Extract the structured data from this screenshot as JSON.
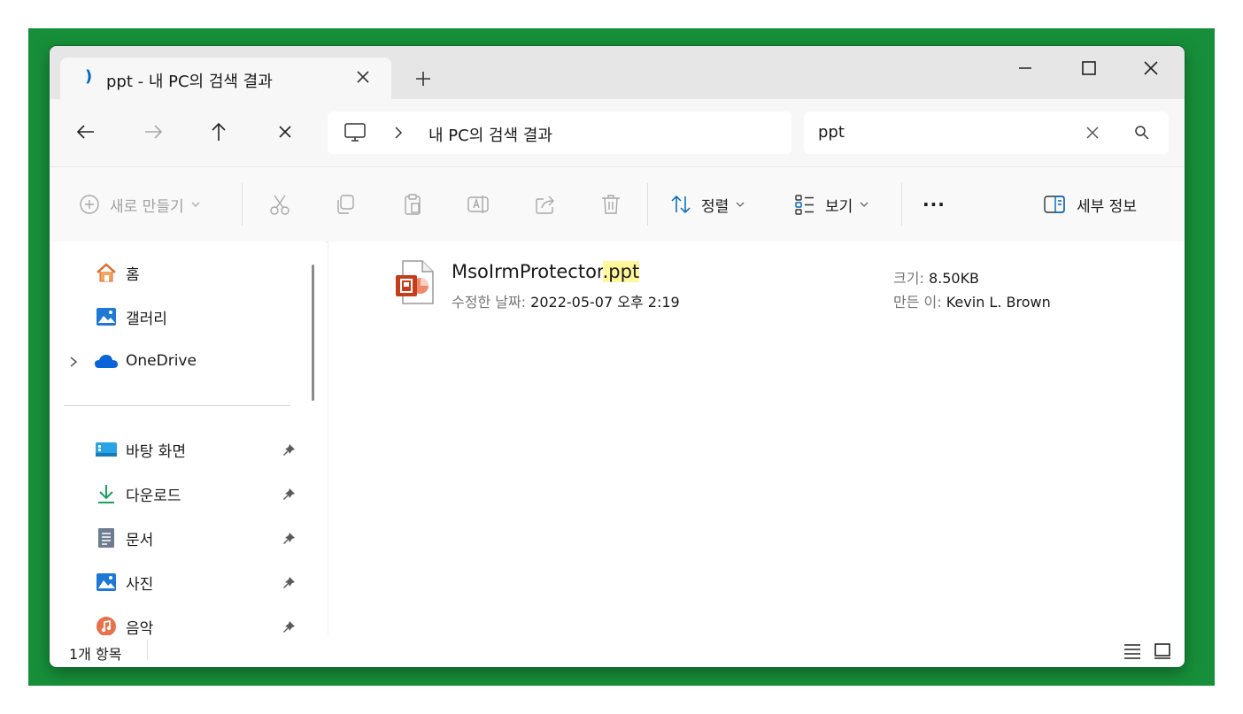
{
  "window": {
    "tab_title": "ppt - 내 PC의 검색 결과",
    "new_tab_label": "+"
  },
  "nav": {
    "address_path": "내 PC의 검색 결과",
    "search_value": "ppt"
  },
  "toolbar": {
    "new_label": "새로 만들기",
    "sort_label": "정렬",
    "view_label": "보기",
    "more_label": "···",
    "details_label": "세부 정보"
  },
  "sidebar": {
    "items": [
      {
        "label": "홈",
        "icon": "home-icon"
      },
      {
        "label": "갤러리",
        "icon": "gallery-icon"
      },
      {
        "label": "OneDrive",
        "icon": "onedrive-icon"
      }
    ],
    "pinned": [
      {
        "label": "바탕 화면",
        "icon": "desktop-icon"
      },
      {
        "label": "다운로드",
        "icon": "download-icon"
      },
      {
        "label": "문서",
        "icon": "documents-icon"
      },
      {
        "label": "사진",
        "icon": "pictures-icon"
      },
      {
        "label": "음악",
        "icon": "music-icon"
      }
    ]
  },
  "file": {
    "name_base": "MsoIrmProtector",
    "name_ext": ".ppt",
    "modified_label": "수정한 날짜:",
    "modified_value": "2022-05-07 오후 2:19",
    "size_label": "크기:",
    "size_value": "8.50KB",
    "author_label": "만든 이:",
    "author_value": "Kevin L. Brown",
    "icon": "powerpoint-file-icon"
  },
  "status": {
    "item_count": "1개 항목"
  },
  "colors": {
    "frame_green": "#178f3a",
    "accent": "#0067c0",
    "highlight": "#fff799",
    "ppt_red": "#c43e1c"
  }
}
